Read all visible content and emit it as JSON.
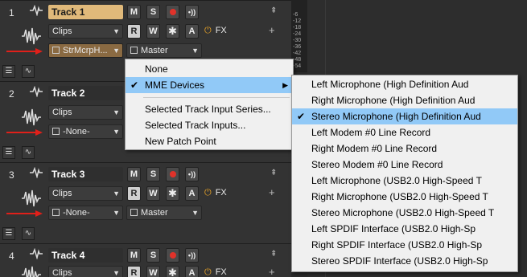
{
  "tracks": [
    {
      "number": "1",
      "name": "Track 1",
      "clips_label": "Clips",
      "input": "StrMcrpH...",
      "output": "Master",
      "fx": "FX"
    },
    {
      "number": "2",
      "name": "Track 2",
      "clips_label": "Clips",
      "input": "-None-"
    },
    {
      "number": "3",
      "name": "Track 3",
      "clips_label": "Clips",
      "input": "-None-",
      "output": "Master",
      "fx": "FX"
    },
    {
      "number": "4",
      "name": "Track 4",
      "clips_label": "Clips",
      "fx": "FX"
    }
  ],
  "buttons": {
    "mute": "M",
    "solo": "S",
    "read": "R",
    "write": "W",
    "auto": "A"
  },
  "meter_ticks": [
    "-6",
    "-12",
    "-18",
    "-24",
    "-30",
    "-36",
    "-42",
    "-48",
    "-54"
  ],
  "input_menu": {
    "items": [
      {
        "label": "None"
      },
      {
        "label": "MME Devices",
        "checked": true,
        "submenu": true
      }
    ],
    "items2": [
      {
        "label": "Selected Track Input Series..."
      },
      {
        "label": "Selected Track Inputs..."
      },
      {
        "label": "New Patch Point"
      }
    ]
  },
  "mme_submenu": {
    "items": [
      {
        "label": "Left Microphone (High Definition Aud"
      },
      {
        "label": "Right Microphone (High Definition Aud"
      },
      {
        "label": "Stereo Microphone (High Definition Aud",
        "checked": true
      },
      {
        "label": "Left Modem #0 Line Record"
      },
      {
        "label": "Right Modem #0 Line Record"
      },
      {
        "label": "Stereo Modem #0 Line Record"
      },
      {
        "label": "Left Microphone (USB2.0 High-Speed T"
      },
      {
        "label": "Right Microphone (USB2.0 High-Speed T"
      },
      {
        "label": "Stereo Microphone (USB2.0 High-Speed T"
      },
      {
        "label": "Left SPDIF Interface (USB2.0 High-Sp"
      },
      {
        "label": "Right SPDIF Interface (USB2.0 High-Sp"
      },
      {
        "label": "Stereo SPDIF Interface (USB2.0 High-Sp"
      }
    ]
  },
  "colors": {
    "accent": "#e0b97a",
    "highlight": "#91c9f7",
    "record": "#e0322a",
    "arrow": "#e0201a"
  }
}
